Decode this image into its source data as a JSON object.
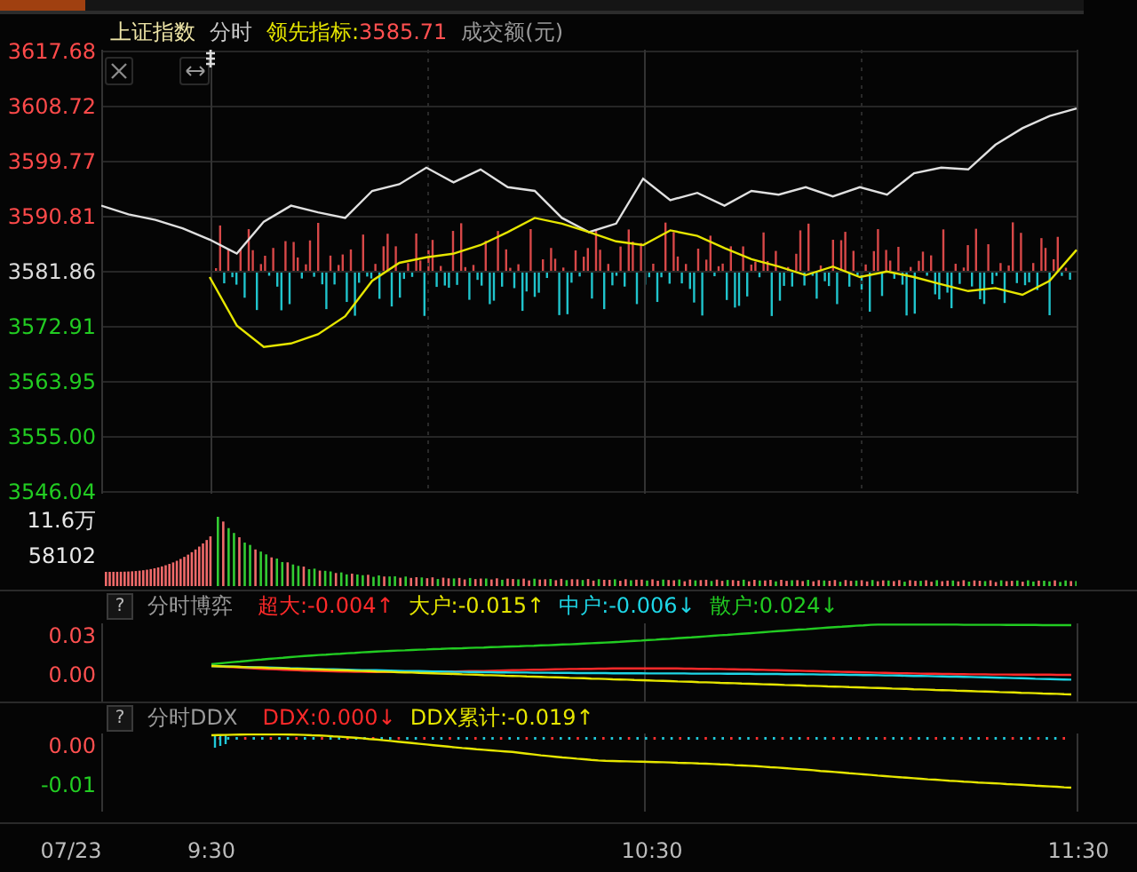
{
  "header": [
    {
      "kind": "label",
      "text": "上证指数",
      "color": "#efe6a8"
    },
    {
      "kind": "label",
      "text": "分时",
      "color": "#c8c8c8"
    },
    {
      "kind": "label",
      "text": "领先指标:",
      "color": "#e6e600"
    },
    {
      "kind": "value",
      "text": "3585.71",
      "color": "#ff5050"
    },
    {
      "kind": "label",
      "text": "成交额(元)",
      "color": "#9a9a9a"
    }
  ],
  "price_chart": {
    "chart_data": {
      "type": "line",
      "grid": true,
      "ylim": [
        3546.04,
        3617.68
      ],
      "yticks": [
        {
          "value": 3617.68,
          "label": "3617.68"
        },
        {
          "value": 3608.72,
          "label": "3608.72"
        },
        {
          "value": 3599.77,
          "label": "3599.77"
        },
        {
          "value": 3590.81,
          "label": "3590.81"
        },
        {
          "value": 3581.86,
          "label": "3581.86"
        },
        {
          "value": 3572.91,
          "label": "3572.91"
        },
        {
          "value": 3563.95,
          "label": "3563.95"
        },
        {
          "value": 3555.0,
          "label": "3555.00"
        },
        {
          "value": 3546.04,
          "label": "3546.04"
        }
      ],
      "series": [
        {
          "color": "#e0e0e0",
          "values": [
            3592.6,
            3591.2,
            3590.3,
            3588.9,
            3587.1,
            3584.8,
            3590.0,
            3592.6,
            3591.5,
            3590.6,
            3595.0,
            3596.1,
            3598.8,
            3596.4,
            3598.5,
            3595.6,
            3595.0,
            3590.6,
            3588.3,
            3589.7,
            3597.0,
            3593.5,
            3594.7,
            3592.6,
            3595.0,
            3594.4,
            3595.6,
            3594.1,
            3595.6,
            3594.4,
            3597.9,
            3598.8,
            3598.5,
            3602.5,
            3605.2,
            3607.2,
            3608.4
          ]
        },
        {
          "color": "#e6e600",
          "values": [
            null,
            null,
            null,
            null,
            3581.0,
            3573.1,
            3569.6,
            3570.2,
            3571.7,
            3574.6,
            3580.4,
            3583.3,
            3584.2,
            3584.8,
            3586.2,
            3588.3,
            3590.6,
            3589.7,
            3588.3,
            3586.8,
            3586.2,
            3588.6,
            3587.7,
            3585.7,
            3583.9,
            3582.7,
            3581.3,
            3582.7,
            3581.0,
            3581.9,
            3581.0,
            3579.8,
            3578.7,
            3579.2,
            3578.1,
            3580.4,
            3585.4
          ]
        }
      ]
    }
  },
  "volume_panel": {
    "axis_labels": [
      {
        "text": "11.6万",
        "color": "#e8e8e8"
      },
      {
        "text": "58102",
        "color": "#e8e8e8"
      }
    ]
  },
  "game_panel": {
    "help": "?",
    "title": "分时博弈",
    "legend": [
      {
        "text": "超大:-0.004↑",
        "color": "#ff2a2a"
      },
      {
        "text": "大户:-0.015↑",
        "color": "#e6e600"
      },
      {
        "text": "中户:-0.006↓",
        "color": "#1ed6e6"
      },
      {
        "text": "散户:0.024↓",
        "color": "#22cc22"
      }
    ],
    "axis_labels": [
      {
        "text": "0.03",
        "color": "#ff5050"
      },
      {
        "text": "0.00",
        "color": "#ff5050"
      }
    ]
  },
  "ddx_panel": {
    "help": "?",
    "title": "分时DDX",
    "legend": [
      {
        "text": "DDX:0.000↓",
        "color": "#ff2a2a"
      },
      {
        "text": "DDX累计:-0.019↑",
        "color": "#e6e600"
      }
    ],
    "axis_labels": [
      {
        "text": "0.00",
        "color": "#ff5050"
      },
      {
        "text": "-0.01",
        "color": "#22cc22"
      }
    ]
  },
  "time_axis": [
    "07/23",
    "9:30",
    "10:30",
    "11:30"
  ]
}
